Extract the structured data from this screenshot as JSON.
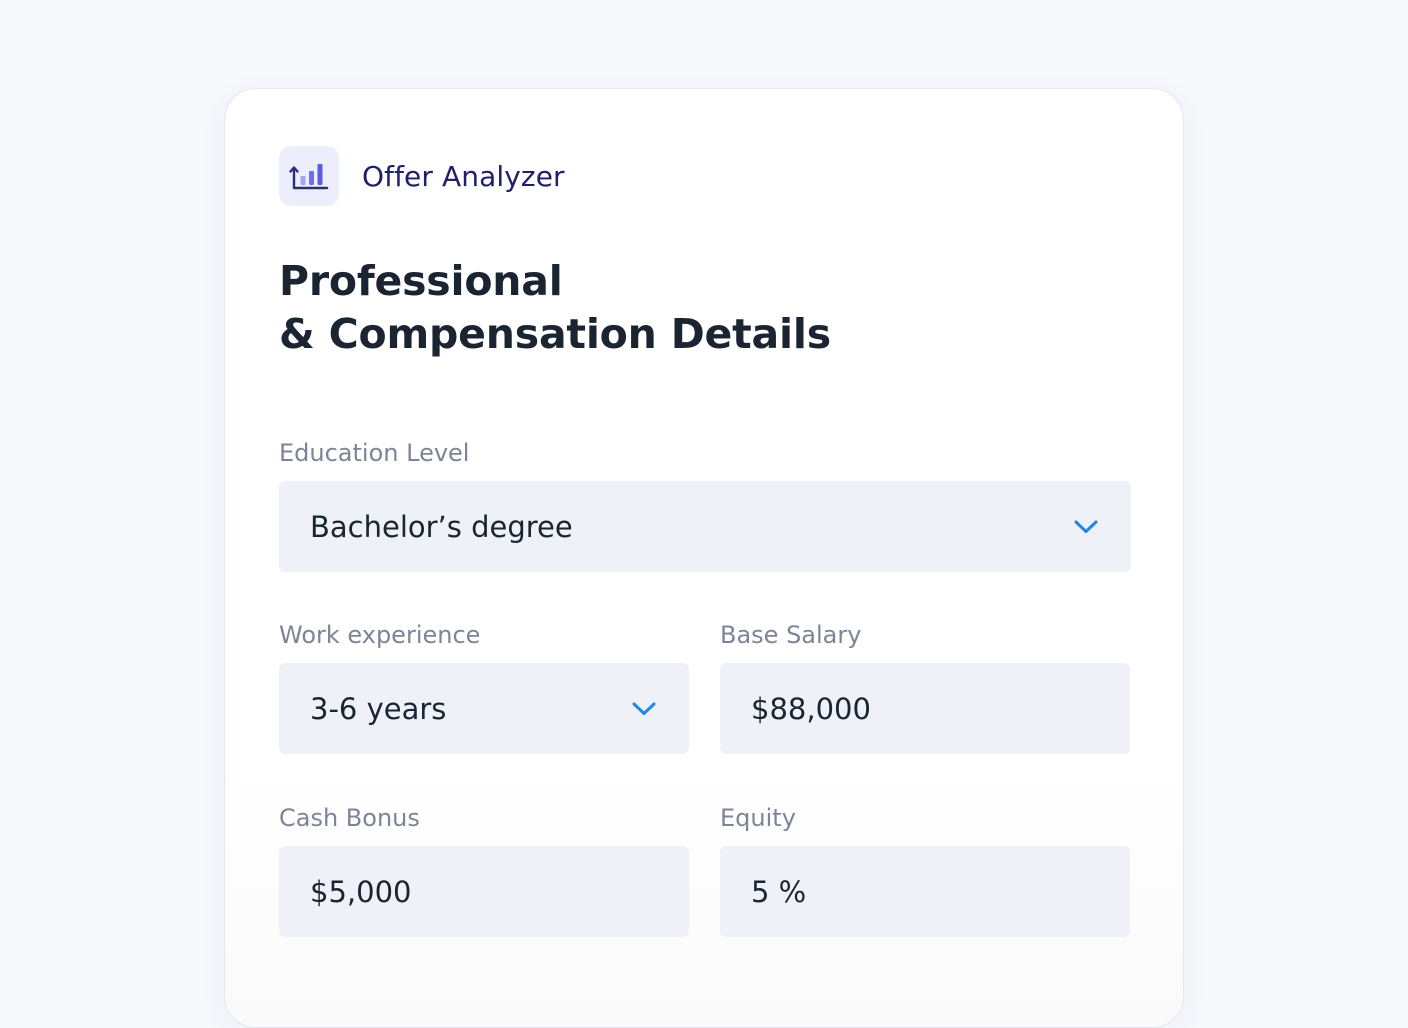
{
  "app": {
    "title": "Offer Analyzer",
    "icon": "bar-chart-growth-icon",
    "accent_color": "#5b5ce2"
  },
  "page": {
    "title_line1": "Professional",
    "title_line2": "& Compensation Details"
  },
  "form": {
    "education": {
      "label": "Education Level",
      "value": "Bachelor’s degree"
    },
    "experience": {
      "label": "Work experience",
      "value": "3-6 years"
    },
    "base_salary": {
      "label": "Base Salary",
      "value": "$88,000"
    },
    "cash_bonus": {
      "label": "Cash Bonus",
      "value": "$5,000"
    },
    "equity": {
      "label": "Equity",
      "value": "5 %"
    }
  },
  "colors": {
    "chevron": "#1e88e5",
    "field_background": "#eef1f8",
    "label": "#7c8598",
    "heading": "#1b2431"
  }
}
